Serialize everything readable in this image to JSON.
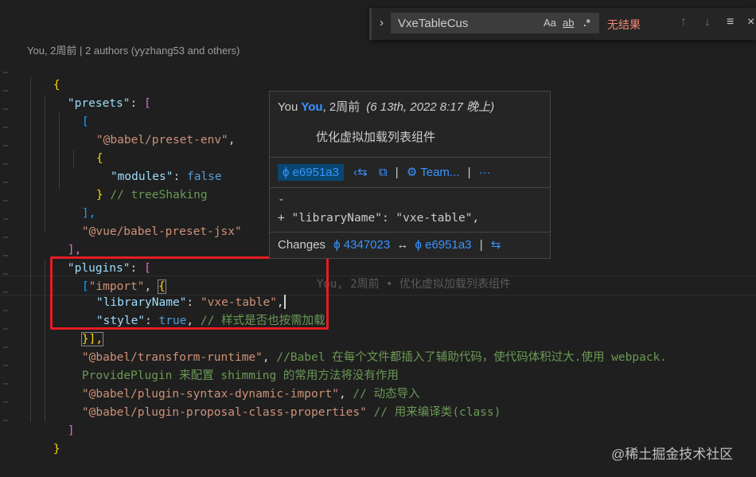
{
  "find": {
    "query": "VxeTableCus",
    "opt_case": "Aa",
    "opt_word": "ab",
    "opt_regex": ".*",
    "result": "无结果",
    "prev": "↑",
    "next": "↓",
    "more": "≡",
    "close": "×",
    "toggle": "›"
  },
  "blame_header": "You, 2周前 | 2 authors (yyzhang53 and others)",
  "inline_blame": "You, 2周前 • 优化虚拟加载列表组件",
  "hover": {
    "avatar_alt": "You",
    "author": "You",
    "relative": ", 2周前",
    "date": "(6 13th, 2022 8:17 晚上)",
    "message": "优化虚拟加载列表组件",
    "sha": "e6951a3",
    "team": "Team...",
    "more": "···",
    "diff_minus": "-",
    "diff_plus": "+ \"libraryName\": \"vxe-table\",",
    "changes_label": "Changes",
    "from_sha": "4347023",
    "arrow": "↔",
    "to_sha": "e6951a3"
  },
  "code": {
    "l1_brace": "{",
    "presets_key": "\"presets\"",
    "colon": ": ",
    "open_bracket": "[",
    "preset_env": "\"@babel/preset-env\"",
    "comma": ",",
    "open_brace": "{",
    "modules_key": "\"modules\"",
    "false_val": "false",
    "close_brace": "}",
    "tree_comment": "// treeShaking",
    "close_bracket_comma": "],",
    "vue_jsx": "\"@vue/babel-preset-jsx\"",
    "plugins_key": "\"plugins\"",
    "import_str": "\"import\"",
    "library_key": "\"libraryName\"",
    "vxe_table": "\"vxe-table\"",
    "style_key": "\"style\"",
    "true_val": "true",
    "style_comment": "// 样式是否也按需加载",
    "close_brace_bracket": "}],",
    "transform_runtime": "\"@babel/transform-runtime\"",
    "runtime_comment": "//Babel 在每个文件都插入了辅助代码，使代码体积过大.使用 webpack.",
    "runtime_comment2": "ProvidePlugin 来配置 shimming 的常用方法将没有作用",
    "dynamic_import": "\"@babel/plugin-syntax-dynamic-import\"",
    "dynamic_comment": "// 动态导入",
    "class_props": "\"@babel/plugin-proposal-class-properties\"",
    "class_comment": "// 用来编译类(class)",
    "close_bracket": "]",
    "last_brace": "}"
  },
  "watermark": "@稀土掘金技术社区",
  "colors": {
    "background": "#1f1f1f",
    "accent": "#3794ff",
    "highlight_box": "#e51c23",
    "no_result": "#f48771"
  }
}
